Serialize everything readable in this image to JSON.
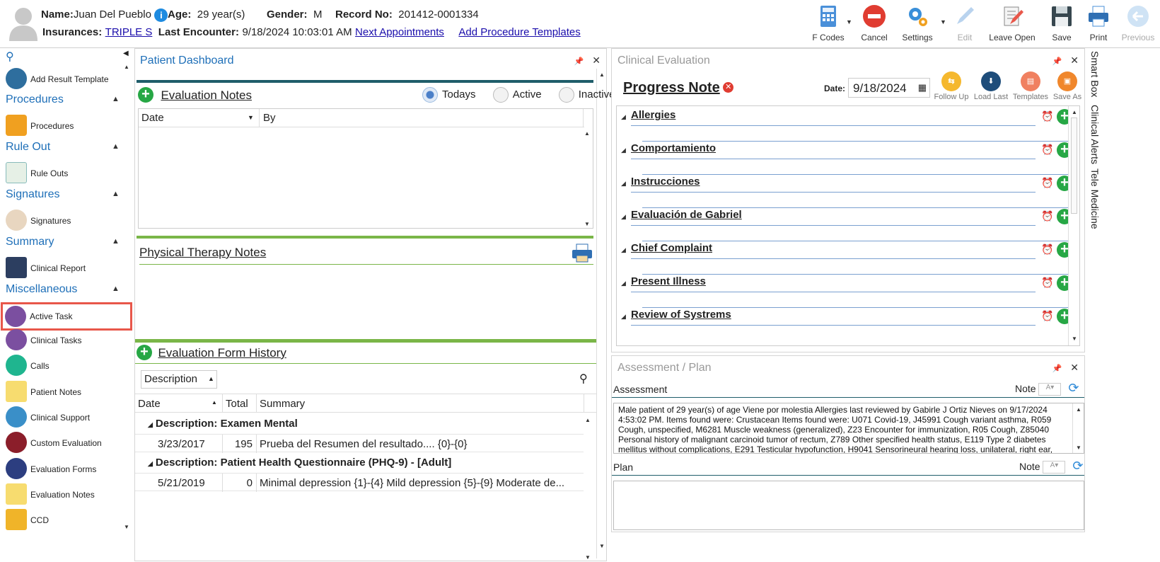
{
  "header": {
    "name_label": "Name:",
    "name_value": "Juan Del Pueblo",
    "age_label": "Age:",
    "age_value": "29 year(s)",
    "gender_label": "Gender:",
    "gender_value": "M",
    "record_label": "Record No:",
    "record_value": "201412-0001334",
    "ins_label": "Insurances:",
    "ins_value": "TRIPLE S",
    "last_label": "Last Encounter:",
    "last_value": "9/18/2024 10:03:01 AM",
    "next_appts": "Next Appointments",
    "add_proc": "Add Procedure Templates"
  },
  "toolbar": {
    "fcodes": "F Codes",
    "cancel": "Cancel",
    "settings": "Settings",
    "edit": "Edit",
    "leave_open": "Leave Open",
    "save": "Save",
    "print": "Print",
    "previous": "Previous"
  },
  "sidebar": {
    "add_result": "Add Result Template",
    "sec_procedures": "Procedures",
    "procedures": "Procedures",
    "sec_ruleout": "Rule Out",
    "ruleouts": "Rule Outs",
    "sec_signatures": "Signatures",
    "signatures": "Signatures",
    "sec_summary": "Summary",
    "clinical_report": "Clinical Report",
    "sec_misc": "Miscellaneous",
    "active_task": "Active Task",
    "clinical_tasks": "Clinical Tasks",
    "calls": "Calls",
    "patient_notes": "Patient Notes",
    "clinical_support": "Clinical Support",
    "custom_eval": "Custom Evaluation",
    "eval_forms": "Evaluation Forms",
    "eval_notes": "Evaluation Notes",
    "ccd": "CCD"
  },
  "dashboard": {
    "title": "Patient Dashboard",
    "eval_notes": "Evaluation Notes",
    "todays": "Todays",
    "active": "Active",
    "inactive": "Inactive",
    "col_date": "Date",
    "col_by": "By",
    "pt_notes": "Physical Therapy Notes",
    "efh": "Evaluation Form History",
    "desc_select": "Description",
    "h_date": "Date",
    "h_total": "Total",
    "h_summary": "Summary",
    "group1": "Description: Examen Mental",
    "r1_date": "3/23/2017",
    "r1_total": "195",
    "r1_summary": "Prueba del Resumen del resultado.... {0}-{0}",
    "group2": "Description: Patient Health Questionnaire (PHQ-9) - [Adult]",
    "r2_date": "5/21/2019",
    "r2_total": "0",
    "r2_summary": "Minimal depression {1}-{4}  Mild depression {5}-{9}  Moderate de..."
  },
  "clinical": {
    "title": "Clinical Evaluation",
    "progress": "Progress Note",
    "date_label": "Date:",
    "date_value": "9/18/2024",
    "follow_up": "Follow Up",
    "load_last": "Load Last",
    "templates": "Templates",
    "save_as": "Save As",
    "sections": [
      "Allergies",
      "Comportamiento",
      "Instrucciones",
      "Evaluación de Gabriel",
      "Chief Complaint",
      "Present Illness",
      "Review of Systrems"
    ]
  },
  "assessment": {
    "title": "Assessment / Plan",
    "assess_label": "Assessment",
    "note_label": "Note",
    "text": "Male patient of 29 year(s) of age Viene por molestia     Allergies last reviewed by Gabirle J Ortiz Nieves on 9/17/2024 4:53:02 PM.    Items found were:  Crustacean  Items found were:  U071 Covid-19, J45991 Cough variant asthma, R059 Cough, unspecified, M6281 Muscle weakness (generalized), Z23 Encounter for immunization, R05 Cough, Z85040 Personal history of malignant carcinoid tumor of rectum, Z789 Other specified health status, E119 Type 2 diabetes mellitus without complications, E291 Testicular hypofunction, H9041 Sensorineural hearing loss, unilateral, right ear, with",
    "plan_label": "Plan",
    "note_label2": "Note"
  },
  "sidetabs": {
    "smart_box": "Smart Box",
    "clinical_alerts": "Clinical Alerts",
    "tele_medicine": "Tele Medicine"
  },
  "colors": {
    "accent_blue": "#1e6fb8",
    "highlight_red": "#e8574a",
    "green": "#27a745"
  }
}
